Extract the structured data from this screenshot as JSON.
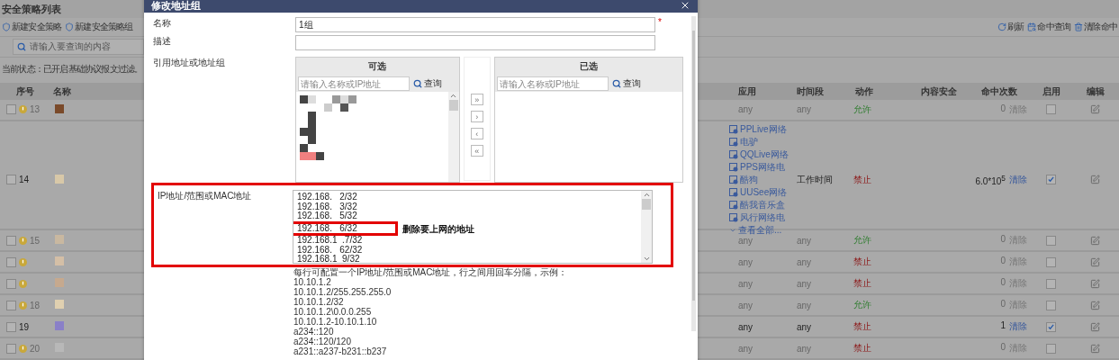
{
  "page": {
    "title": "安全策略列表",
    "toolbar_left": [
      {
        "label": "新建安全策略"
      },
      {
        "label": "新建安全策略组"
      }
    ],
    "toolbar_right": [
      {
        "label": "刷新",
        "kind": "refresh"
      },
      {
        "label": "命中查询",
        "kind": "query"
      },
      {
        "label": "清除命中",
        "kind": "clear"
      }
    ],
    "search": {
      "placeholder": "请输入要查询的内容"
    },
    "status": "当前状态：已开启基础协议报文过滤。"
  },
  "table": {
    "columns": [
      "序号",
      "名称",
      "应用",
      "时间段",
      "动作",
      "内容安全",
      "命中次数",
      "启用",
      "编辑"
    ],
    "rows": [
      {
        "checked": false,
        "seq": "13",
        "warning": true,
        "app": "any",
        "time": "any",
        "action": {
          "kind": "allow",
          "label": "允许"
        },
        "hits": "0",
        "clear": "清除",
        "enabled": false
      },
      {
        "checked": false,
        "seq": "14",
        "warning": false,
        "apps": [
          "PPLive网络",
          "电驴",
          "QQLive网络",
          "PPS网络电",
          "酷狗",
          "UUSee网络",
          "酷我音乐盒",
          "风行网络电"
        ],
        "more": "查看全部...",
        "time": "工作时间",
        "action": {
          "kind": "deny",
          "label": "禁止"
        },
        "hits": "6.0*10$^{5}$",
        "clear": "清除",
        "enabled": true
      },
      {
        "checked": false,
        "seq": "15",
        "warning": true,
        "app": "any",
        "time": "any",
        "action": {
          "kind": "allow",
          "label": "允许"
        },
        "hits": "0",
        "clear": "清除",
        "enabled": false
      },
      {
        "checked": false,
        "warning": true,
        "app": "any",
        "time": "any",
        "action": {
          "kind": "deny",
          "label": "禁止"
        },
        "hits": "0",
        "clear": "清除",
        "enabled": false
      },
      {
        "checked": false,
        "warning": true,
        "app": "any",
        "time": "any",
        "action": {
          "kind": "deny",
          "label": "禁止"
        },
        "hits": "0",
        "clear": "清除",
        "enabled": false
      },
      {
        "checked": false,
        "seq": "18",
        "warning": true,
        "app": "any",
        "time": "any",
        "action": {
          "kind": "allow",
          "label": "允许"
        },
        "hits": "0",
        "clear": "清除",
        "enabled": false
      },
      {
        "checked": false,
        "seq": "19",
        "warning": false,
        "app": "any",
        "time": "any",
        "action": {
          "kind": "deny",
          "label": "禁止"
        },
        "hits": "1",
        "clear": "清除",
        "enabled": true
      },
      {
        "checked": false,
        "seq": "20",
        "warning": true,
        "app": "any",
        "time": "any",
        "action": {
          "kind": "deny",
          "label": "禁止"
        },
        "hits": "0",
        "clear": "清除",
        "enabled": false
      }
    ]
  },
  "dialog": {
    "title": "修改地址组",
    "fields": [
      {
        "label": "名称",
        "value": "1组",
        "required_mark": "*"
      },
      {
        "label": "描述"
      }
    ],
    "reference": {
      "label": "引用地址或地址组",
      "available": {
        "header": "可选",
        "placeholder": "请输入名称或IP地址",
        "button": "查询"
      },
      "chosen": {
        "header": "已选",
        "placeholder": "请输入名称或IP地址",
        "button": "查询"
      },
      "move_buttons": [
        "»",
        "›",
        "‹",
        "«"
      ]
    },
    "ip": {
      "label": "IP地址/范围或MAC地址",
      "lines": [
        {
          "text": "192.168.   2/32",
          "highlighted": false
        },
        {
          "text": "192.168.   3/32",
          "highlighted": false
        },
        {
          "text": "192.168.   5/32",
          "highlighted": false
        },
        {
          "text": "192.168.   6/32",
          "highlighted": true
        },
        {
          "text": "192.168.1  .7/32",
          "highlighted": false
        },
        {
          "text": "192.168.   62/32",
          "highlighted": false
        },
        {
          "text": "192.168.1  9/32",
          "highlighted": false
        }
      ],
      "annotation": "删除要上网的地址",
      "hint": "每行可配置一个IP地址/范围或MAC地址，行之间用回车分隔，示例：",
      "examples": [
        "10.10.1.2",
        "10.10.1.2/255.255.255.0",
        "10.10.1.2/32",
        "10.10.1.2\\0.0.0.255",
        "10.10.1.2-10.10.1.10",
        "a234::120",
        "a234::120/120",
        "a231::a237-b231::b237"
      ]
    }
  }
}
